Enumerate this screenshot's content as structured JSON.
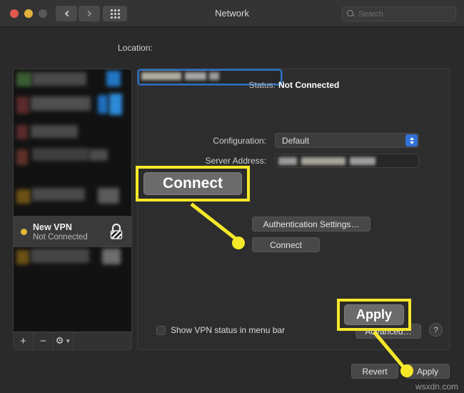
{
  "window": {
    "title": "Network",
    "traffic_lights": [
      "close",
      "minimize",
      "zoom"
    ],
    "nav_back_icon": "chevron-left-icon",
    "nav_forward_icon": "chevron-right-icon",
    "show_all_icon": "grid-icon"
  },
  "search": {
    "placeholder": "Search",
    "icon": "search-icon"
  },
  "location": {
    "label": "Location:",
    "value": "Home"
  },
  "sidebar": {
    "selected": {
      "name": "New VPN",
      "status": "Not Connected",
      "status_dot": "orange-dot-icon",
      "lock_icon": "lock-icon"
    },
    "toolbar": {
      "add_label": "+",
      "remove_label": "−",
      "gear_icon": "gear-icon",
      "gear_chevron": "chevron-down-icon"
    }
  },
  "panel": {
    "status_label": "Status:",
    "status_value": "Not Connected",
    "configuration_label": "Configuration:",
    "configuration_value": "Default",
    "server_address_label": "Server Address:",
    "server_address_value": "",
    "account_name_value": "",
    "auth_settings_label": "Authentication Settings…",
    "connect_label": "Connect",
    "show_status_label": "Show VPN status in menu bar",
    "advanced_label": "Advanced…",
    "help_label": "?"
  },
  "footer": {
    "revert_label": "Revert",
    "apply_label": "Apply"
  },
  "callouts": {
    "connect_label": "Connect",
    "apply_label": "Apply",
    "highlight_color": "#f5e829"
  },
  "watermark": "wsxdn.com"
}
